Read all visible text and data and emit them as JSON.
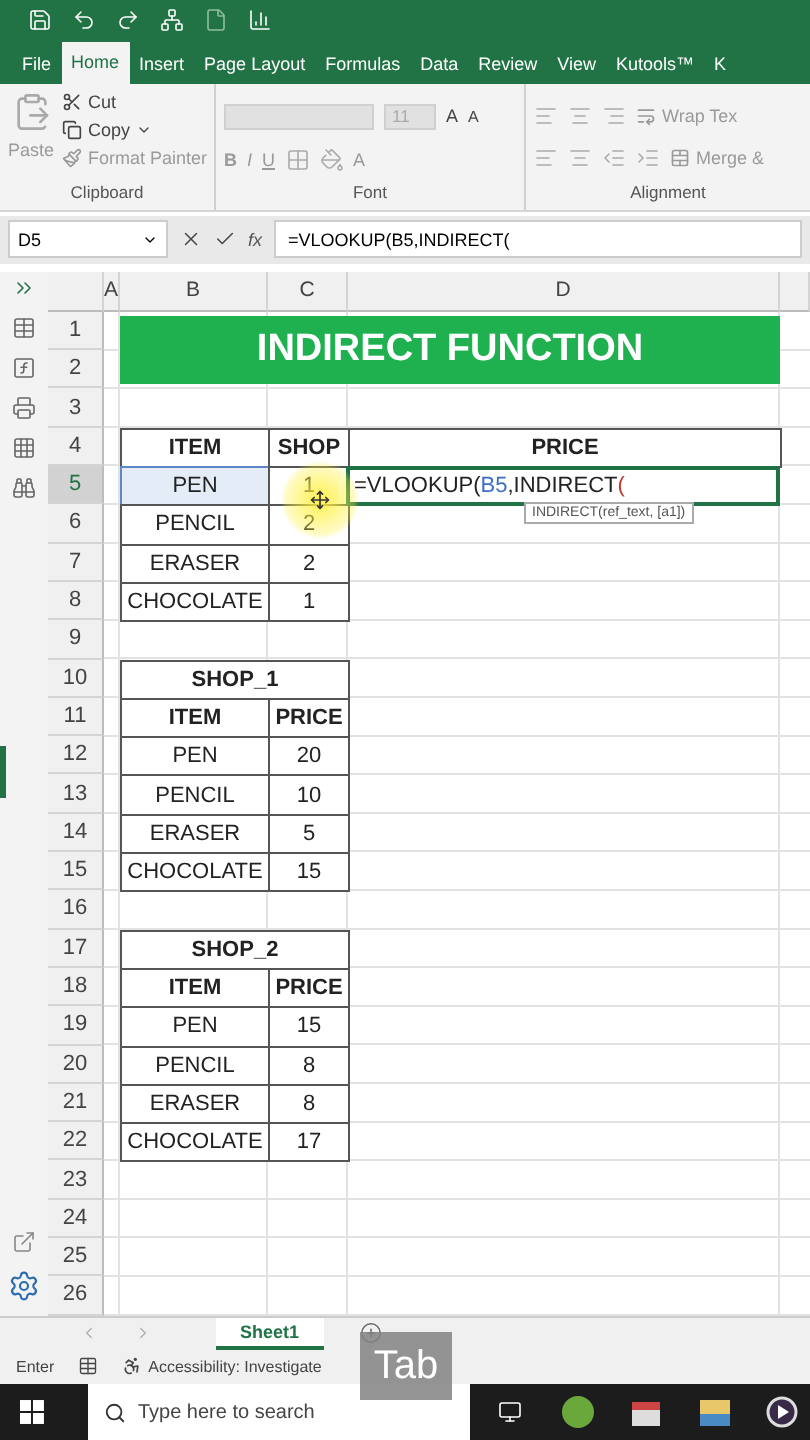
{
  "tabs": [
    {
      "label": "File",
      "selected": false
    },
    {
      "label": "Home",
      "selected": true
    },
    {
      "label": "Insert",
      "selected": false
    },
    {
      "label": "Page Layout",
      "selected": false
    },
    {
      "label": "Formulas",
      "selected": false
    },
    {
      "label": "Data",
      "selected": false
    },
    {
      "label": "Review",
      "selected": false
    },
    {
      "label": "View",
      "selected": false
    },
    {
      "label": "Kutools™",
      "selected": false
    },
    {
      "label": "K",
      "selected": false
    }
  ],
  "ribbon": {
    "clipboard": {
      "paste": "Paste",
      "cut": "Cut",
      "copy": "Copy",
      "format_painter": "Format Painter",
      "label": "Clipboard"
    },
    "font": {
      "size": "11",
      "grow": "A",
      "shrink": "A",
      "bold": "B",
      "italic": "I",
      "underline": "U",
      "font_color_button": "A",
      "label": "Font"
    },
    "alignment": {
      "wrap": "Wrap Tex",
      "merge": "Merge &",
      "label": "Alignment"
    }
  },
  "formula_bar": {
    "name_box": "D5",
    "function_label": "fx",
    "formula": "=VLOOKUP(B5,INDIRECT("
  },
  "columns": [
    {
      "label": "A"
    },
    {
      "label": "B"
    },
    {
      "label": "C"
    },
    {
      "label": "D"
    }
  ],
  "rows": [
    {
      "number": "1",
      "selected": false,
      "kind": "title",
      "title": "INDIRECT FUNCTION"
    },
    {
      "number": "2",
      "selected": false
    },
    {
      "number": "3",
      "selected": false
    },
    {
      "number": "4",
      "selected": false,
      "kind": "header",
      "cells": {
        "b": {
          "text": "ITEM"
        },
        "c": {
          "text": "SHOP"
        },
        "d": {
          "text": "PRICE"
        }
      }
    },
    {
      "number": "5",
      "selected": true,
      "kind": "data",
      "cells": {
        "b": {
          "text": "PEN",
          "selected": true
        },
        "c": {
          "text": "1"
        },
        "d": {
          "active": true,
          "parts": [
            {
              "text": "=VLOOKUP(",
              "color": "#222222"
            },
            {
              "text": "B5",
              "color": "#3b6fc4"
            },
            {
              "text": ",INDIRECT",
              "color": "#222222"
            },
            {
              "text": "(",
              "color": "#c0392b"
            }
          ]
        }
      }
    },
    {
      "number": "6",
      "selected": false,
      "kind": "data",
      "cells": {
        "b": {
          "text": "PENCIL"
        },
        "c": {
          "text": "2"
        }
      }
    },
    {
      "number": "7",
      "selected": false,
      "kind": "data",
      "cells": {
        "b": {
          "text": "ERASER"
        },
        "c": {
          "text": "2"
        }
      }
    },
    {
      "number": "8",
      "selected": false,
      "kind": "data",
      "cells": {
        "b": {
          "text": "CHOCOLATE"
        },
        "c": {
          "text": "1"
        }
      }
    },
    {
      "number": "9",
      "selected": false
    },
    {
      "number": "10",
      "selected": false,
      "kind": "caption",
      "caption": "SHOP_1"
    },
    {
      "number": "11",
      "selected": false,
      "kind": "header",
      "cells": {
        "b": {
          "text": "ITEM"
        },
        "c": {
          "text": "PRICE"
        }
      }
    },
    {
      "number": "12",
      "selected": false,
      "kind": "data",
      "cells": {
        "b": {
          "text": "PEN"
        },
        "c": {
          "text": "20"
        }
      }
    },
    {
      "number": "13",
      "selected": false,
      "kind": "data",
      "cells": {
        "b": {
          "text": "PENCIL"
        },
        "c": {
          "text": "10"
        }
      }
    },
    {
      "number": "14",
      "selected": false,
      "kind": "data",
      "cells": {
        "b": {
          "text": "ERASER"
        },
        "c": {
          "text": "5"
        }
      }
    },
    {
      "number": "15",
      "selected": false,
      "kind": "data",
      "cells": {
        "b": {
          "text": "CHOCOLATE"
        },
        "c": {
          "text": "15"
        }
      }
    },
    {
      "number": "16",
      "selected": false
    },
    {
      "number": "17",
      "selected": false,
      "kind": "caption",
      "caption": "SHOP_2"
    },
    {
      "number": "18",
      "selected": false,
      "kind": "header",
      "cells": {
        "b": {
          "text": "ITEM"
        },
        "c": {
          "text": "PRICE"
        }
      }
    },
    {
      "number": "19",
      "selected": false,
      "kind": "data",
      "cells": {
        "b": {
          "text": "PEN"
        },
        "c": {
          "text": "15"
        }
      }
    },
    {
      "number": "20",
      "selected": false,
      "kind": "data",
      "cells": {
        "b": {
          "text": "PENCIL"
        },
        "c": {
          "text": "8"
        }
      }
    },
    {
      "number": "21",
      "selected": false,
      "kind": "data",
      "cells": {
        "b": {
          "text": "ERASER"
        },
        "c": {
          "text": "8"
        }
      }
    },
    {
      "number": "22",
      "selected": false,
      "kind": "data",
      "cells": {
        "b": {
          "text": "CHOCOLATE"
        },
        "c": {
          "text": "17"
        }
      }
    },
    {
      "number": "23",
      "selected": false
    },
    {
      "number": "24",
      "selected": false
    },
    {
      "number": "25",
      "selected": false
    },
    {
      "number": "26",
      "selected": false
    }
  ],
  "tooltip": "INDIRECT(ref_text, [a1])",
  "sheet_tabs": [
    {
      "label": "Sheet1",
      "selected": true
    }
  ],
  "status_bar": {
    "mode": "Enter",
    "accessibility": "Accessibility: Investigate"
  },
  "key_overlay": "Tab",
  "taskbar": {
    "search": {
      "placeholder": "Type here to search"
    }
  }
}
